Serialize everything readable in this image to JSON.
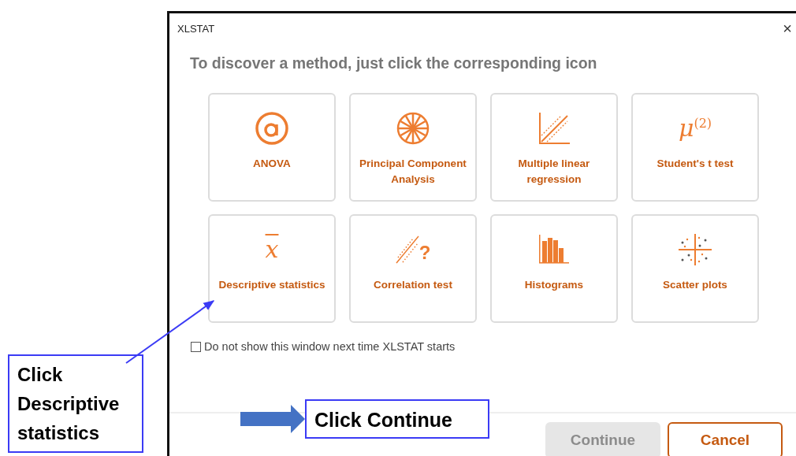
{
  "window": {
    "title": "XLSTAT",
    "close": "×"
  },
  "heading": "To discover a method, just click the corresponding icon",
  "methods": [
    {
      "label": "ANOVA",
      "kind": "at"
    },
    {
      "label": "Principal Component Analysis",
      "kind": "wheel"
    },
    {
      "label": "Multiple linear regression",
      "kind": "regression"
    },
    {
      "label": "Student's t test",
      "kind": "mu",
      "symbol": "μ$^{(2)}$"
    },
    {
      "label": "Descriptive statistics",
      "kind": "mean",
      "symbol": "x"
    },
    {
      "label": "Correlation test",
      "kind": "correlation",
      "symbol": "?"
    },
    {
      "label": "Histograms",
      "kind": "histogram"
    },
    {
      "label": "Scatter plots",
      "kind": "scatter"
    }
  ],
  "dont_show": {
    "label": "Do not show this window next time XLSTAT starts",
    "checked": false
  },
  "buttons": [
    {
      "label": "Continue",
      "kind": "primary",
      "disabled": true
    },
    {
      "label": "Cancel",
      "kind": "secondary",
      "disabled": false
    }
  ],
  "annotations": [
    {
      "text": "Click Descriptive statistics",
      "kind": "pointer"
    },
    {
      "text": "Click Continue",
      "kind": "block-arrow"
    }
  ]
}
